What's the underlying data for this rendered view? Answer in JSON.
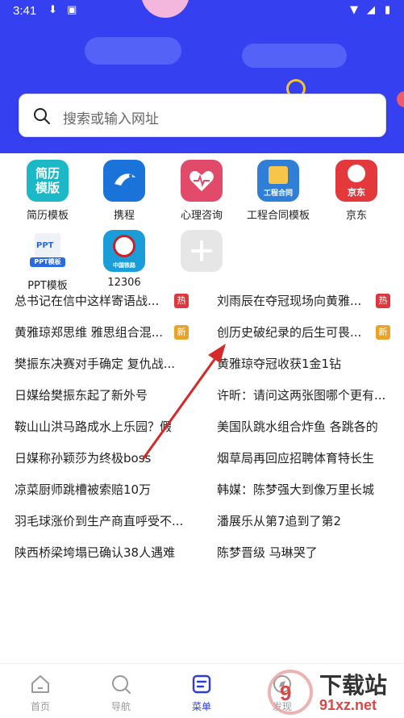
{
  "status_bar": {
    "time": "3:41"
  },
  "search": {
    "placeholder": "搜索或输入网址"
  },
  "apps": [
    {
      "label": "简历模板",
      "icon_text": "简历\n模版",
      "color": "#1db8c8",
      "icon": "resume-template-icon"
    },
    {
      "label": "携程",
      "icon_text": "携程",
      "color": "#1a73d9",
      "icon": "ctrip-icon"
    },
    {
      "label": "心理咨询",
      "icon_text": "",
      "color": "#e24a6a",
      "icon": "heart-icon"
    },
    {
      "label": "工程合同模板",
      "icon_text": "工程合同",
      "color": "#2f7fd8",
      "icon": "contract-template-icon"
    },
    {
      "label": "京东",
      "icon_text": "京东",
      "color": "#e4393c",
      "icon": "jd-icon"
    },
    {
      "label": "PPT模板",
      "icon_text": "PPT模板",
      "color": "#ffffff",
      "icon": "ppt-template-icon"
    },
    {
      "label": "12306",
      "icon_text": "中国铁路",
      "color": "#1b9dd9",
      "icon": "railway-icon"
    },
    {
      "label": "",
      "icon_text": "",
      "color": "#e6e6e6",
      "icon": "add-icon"
    }
  ],
  "news": [
    {
      "left": "总书记在信中这样寄语战...",
      "left_badge": "热",
      "right": "刘雨辰在夺冠现场向黄雅...",
      "right_badge": "热"
    },
    {
      "left": "黄雅琼郑思维 雅思组合混...",
      "left_badge": "新",
      "right": "创历史破纪录的后生可畏...",
      "right_badge": "新"
    },
    {
      "left": "樊振东决赛对手确定 复仇战...",
      "left_badge": "",
      "right": "黄雅琼夺冠收获1金1钻",
      "right_badge": ""
    },
    {
      "left": "日媒给樊振东起了新外号",
      "left_badge": "",
      "right": "许昕：请问这两张图哪个更有...",
      "right_badge": ""
    },
    {
      "left": "鞍山山洪马路成水上乐园？假",
      "left_badge": "",
      "right": "美国队跳水组合炸鱼 各跳各的",
      "right_badge": ""
    },
    {
      "left": "日媒称孙颖莎为终极boss",
      "left_badge": "",
      "right": "烟草局再回应招聘体育特长生",
      "right_badge": ""
    },
    {
      "left": "凉菜厨师跳槽被索赔10万",
      "left_badge": "",
      "right": "韩媒：陈梦强大到像万里长城",
      "right_badge": ""
    },
    {
      "left": "羽毛球涨价到生产商直呼受不...",
      "left_badge": "",
      "right": "潘展乐从第7追到了第2",
      "right_badge": ""
    },
    {
      "left": "陕西桥梁垮塌已确认38人遇难",
      "left_badge": "",
      "right": "陈梦晋级 马琳哭了",
      "right_badge": ""
    }
  ],
  "nav": [
    {
      "label": "首页",
      "icon": "home-icon",
      "active": false
    },
    {
      "label": "导航",
      "icon": "compass-icon",
      "active": false
    },
    {
      "label": "菜单",
      "icon": "menu-icon",
      "active": true
    },
    {
      "label": "发现",
      "icon": "discover-icon",
      "active": false
    }
  ],
  "watermark": {
    "text": "下载站",
    "domain": "91xz.net"
  },
  "colors": {
    "header": "#3540f0",
    "accent": "#2f3bd6",
    "hot": "#e0353d",
    "new": "#e8a42a",
    "arrow": "#d42a2a"
  }
}
